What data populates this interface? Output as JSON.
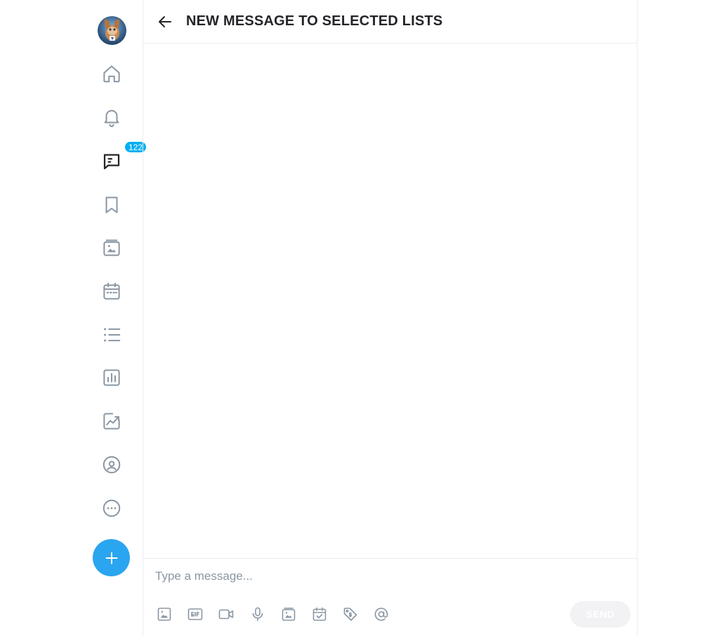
{
  "header": {
    "back_icon": "arrow-left-icon",
    "title": "NEW MESSAGE TO SELECTED LISTS"
  },
  "sidebar": {
    "avatar_icon": "user-avatar",
    "items": [
      {
        "name": "home",
        "icon": "home-icon"
      },
      {
        "name": "notifications",
        "icon": "bell-icon"
      },
      {
        "name": "messages",
        "icon": "chat-icon",
        "badge": "122"
      },
      {
        "name": "bookmarks",
        "icon": "bookmark-icon"
      },
      {
        "name": "vault",
        "icon": "image-folder-icon"
      },
      {
        "name": "queue",
        "icon": "calendar-icon"
      },
      {
        "name": "lists",
        "icon": "list-icon"
      },
      {
        "name": "statistics",
        "icon": "bar-chart-icon"
      },
      {
        "name": "analytics",
        "icon": "trend-chart-icon"
      },
      {
        "name": "profile",
        "icon": "profile-icon"
      },
      {
        "name": "more",
        "icon": "more-icon"
      }
    ],
    "fab_icon": "plus-icon"
  },
  "compose": {
    "placeholder": "Type a message...",
    "value": "",
    "tools": [
      "image-icon",
      "gif-icon",
      "video-icon",
      "microphone-icon",
      "vault-icon",
      "schedule-icon",
      "price-tag-icon",
      "mention-icon"
    ],
    "send_label": "SEND"
  },
  "colors": {
    "accent": "#00aff0",
    "fab": "#2aa5ef",
    "icon_gray": "#8a96a3",
    "text": "#242529",
    "border": "#ececef",
    "send_disabled_bg": "#f2f2f4"
  }
}
